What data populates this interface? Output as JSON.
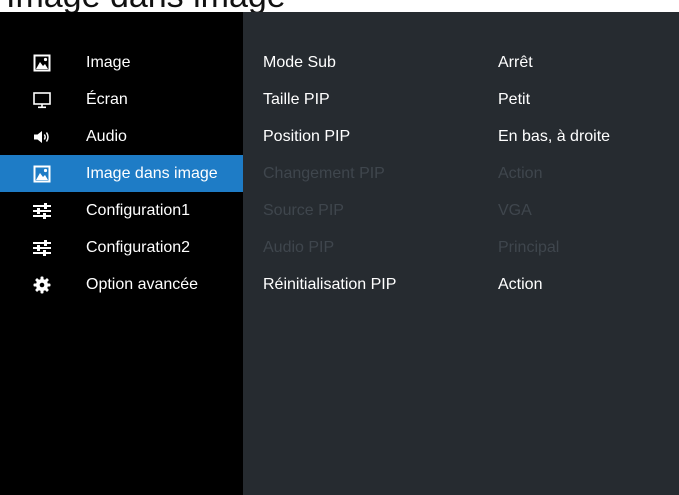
{
  "header": {
    "title": "Image dans image"
  },
  "menu": {
    "items": [
      {
        "label": "Image",
        "icon": "image-icon",
        "selected": false
      },
      {
        "label": "Écran",
        "icon": "monitor-icon",
        "selected": false
      },
      {
        "label": "Audio",
        "icon": "speaker-icon",
        "selected": false
      },
      {
        "label": "Image dans image",
        "icon": "image-icon",
        "selected": true
      },
      {
        "label": "Configuration1",
        "icon": "sliders-icon",
        "selected": false
      },
      {
        "label": "Configuration2",
        "icon": "sliders-icon",
        "selected": false
      },
      {
        "label": "Option avancée",
        "icon": "gear-icon",
        "selected": false
      }
    ]
  },
  "settings": {
    "rows": [
      {
        "name": "Mode Sub",
        "value": "Arrêt",
        "enabled": true
      },
      {
        "name": "Taille PIP",
        "value": "Petit",
        "enabled": true
      },
      {
        "name": "Position PIP",
        "value": "En bas, à droite",
        "enabled": true
      },
      {
        "name": "Changement PIP",
        "value": "Action",
        "enabled": false
      },
      {
        "name": "Source PIP",
        "value": "VGA",
        "enabled": false
      },
      {
        "name": "Audio PIP",
        "value": "Principal",
        "enabled": false
      },
      {
        "name": "Réinitialisation PIP",
        "value": "Action",
        "enabled": true
      }
    ]
  },
  "colors": {
    "menu_background": "#000000",
    "panel_background": "#262b30",
    "selected_highlight": "#1e7cc6",
    "disabled_text": "#3f464d"
  }
}
